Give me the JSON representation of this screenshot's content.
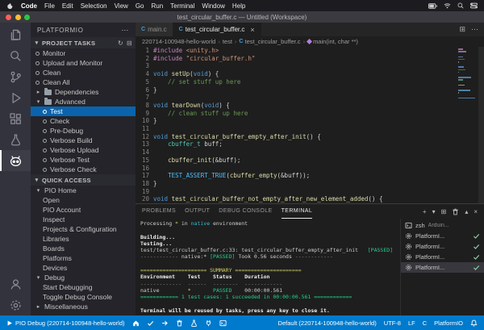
{
  "icons": {
    "more": "⋯",
    "refresh": "↻",
    "collapse": "⊟",
    "chevron_down": "▾",
    "chevron_right": "▸",
    "close": "×",
    "plus": "+",
    "split": "⊞",
    "chevron_up": "▴",
    "overflow": "⋯",
    "breadcrumb_sep": "›"
  },
  "menubar": {
    "app_name": "Code",
    "items": [
      "File",
      "Edit",
      "Selection",
      "View",
      "Go",
      "Run",
      "Terminal",
      "Window",
      "Help"
    ],
    "status_icons": [
      "battery",
      "wifi",
      "search",
      "control-center"
    ]
  },
  "titlebar": {
    "title": "test_circular_buffer.c — Untitled (Workspace)"
  },
  "activity_bar": {
    "items": [
      {
        "name": "explorer",
        "active": false
      },
      {
        "name": "search",
        "active": false
      },
      {
        "name": "source-control",
        "active": false
      },
      {
        "name": "run-and-debug",
        "active": false
      },
      {
        "name": "extensions",
        "active": false
      },
      {
        "name": "testing",
        "active": false
      },
      {
        "name": "platformio",
        "active": true
      },
      {
        "name": "accounts",
        "active": false,
        "bottom": true
      },
      {
        "name": "settings",
        "active": false,
        "bottom": true
      }
    ]
  },
  "sidebar": {
    "title": "PLATFORMIO",
    "sections": [
      {
        "label": "PROJECT TASKS",
        "items": [
          {
            "icon": "task",
            "label": "Monitor",
            "indent": 0
          },
          {
            "icon": "task",
            "label": "Upload and Monitor",
            "indent": 0
          },
          {
            "icon": "task",
            "label": "Clean",
            "indent": 0
          },
          {
            "icon": "task",
            "label": "Clean All",
            "indent": 0
          },
          {
            "icon": "folder-closed",
            "label": "Dependencies",
            "indent": 0
          },
          {
            "icon": "folder-open",
            "label": "Advanced",
            "indent": 0
          },
          {
            "icon": "task",
            "label": "Test",
            "indent": 1,
            "selected": true
          },
          {
            "icon": "task",
            "label": "Check",
            "indent": 1
          },
          {
            "icon": "task",
            "label": "Pre-Debug",
            "indent": 1
          },
          {
            "icon": "task",
            "label": "Verbose Build",
            "indent": 1
          },
          {
            "icon": "task",
            "label": "Verbose Upload",
            "indent": 1
          },
          {
            "icon": "task",
            "label": "Verbose Test",
            "indent": 1
          },
          {
            "icon": "task",
            "label": "Verbose Check",
            "indent": 1
          }
        ]
      },
      {
        "label": "QUICK ACCESS",
        "items": [
          {
            "icon": "chevron-down",
            "label": "PIO Home",
            "indent": 0
          },
          {
            "icon": "none",
            "label": "Open",
            "indent": 1
          },
          {
            "icon": "none",
            "label": "PIO Account",
            "indent": 1
          },
          {
            "icon": "none",
            "label": "Inspect",
            "indent": 1
          },
          {
            "icon": "none",
            "label": "Projects & Configuration",
            "indent": 1
          },
          {
            "icon": "none",
            "label": "Libraries",
            "indent": 1
          },
          {
            "icon": "none",
            "label": "Boards",
            "indent": 1
          },
          {
            "icon": "none",
            "label": "Platforms",
            "indent": 1
          },
          {
            "icon": "none",
            "label": "Devices",
            "indent": 1
          },
          {
            "icon": "chevron-down",
            "label": "Debug",
            "indent": 0
          },
          {
            "icon": "none",
            "label": "Start Debugging",
            "indent": 1
          },
          {
            "icon": "none",
            "label": "Toggle Debug Console",
            "indent": 1
          },
          {
            "icon": "chevron-right",
            "label": "Miscellaneous",
            "indent": 0
          }
        ]
      }
    ]
  },
  "editor": {
    "tabs": [
      {
        "label": "main.c",
        "active": false
      },
      {
        "label": "test_circular_buffer.c",
        "active": true
      }
    ],
    "breadcrumb": [
      {
        "label": "220714-100948-hello-world",
        "icon": "none"
      },
      {
        "label": "test",
        "icon": "none"
      },
      {
        "label": "test_circular_buffer.c",
        "icon": "c-file"
      },
      {
        "label": "main(int, char **)",
        "icon": "symbol-method"
      }
    ],
    "code_lines": [
      {
        "n": 1,
        "tokens": [
          [
            "pp",
            "#include"
          ],
          [
            "pl",
            " "
          ],
          [
            "str",
            "<unity.h>"
          ]
        ]
      },
      {
        "n": 2,
        "tokens": [
          [
            "pp",
            "#include"
          ],
          [
            "pl",
            " "
          ],
          [
            "str",
            "\"circular_buffer.h\""
          ]
        ]
      },
      {
        "n": 3,
        "tokens": []
      },
      {
        "n": 4,
        "tokens": [
          [
            "kw",
            "void"
          ],
          [
            "pl",
            " "
          ],
          [
            "fn",
            "setUp"
          ],
          [
            "pl",
            "("
          ],
          [
            "kw",
            "void"
          ],
          [
            "pl",
            ") {"
          ]
        ]
      },
      {
        "n": 5,
        "tokens": [
          [
            "cm",
            "    // set stuff up here"
          ]
        ]
      },
      {
        "n": 6,
        "tokens": [
          [
            "pl",
            "}"
          ]
        ]
      },
      {
        "n": 7,
        "tokens": []
      },
      {
        "n": 8,
        "tokens": [
          [
            "kw",
            "void"
          ],
          [
            "pl",
            " "
          ],
          [
            "fn",
            "tearDown"
          ],
          [
            "pl",
            "("
          ],
          [
            "kw",
            "void"
          ],
          [
            "pl",
            ") {"
          ]
        ]
      },
      {
        "n": 9,
        "tokens": [
          [
            "cm",
            "    // clean stuff up here"
          ]
        ]
      },
      {
        "n": 10,
        "tokens": [
          [
            "pl",
            "}"
          ]
        ]
      },
      {
        "n": 11,
        "tokens": []
      },
      {
        "n": 12,
        "tokens": [
          [
            "kw",
            "void"
          ],
          [
            "pl",
            " "
          ],
          [
            "fn",
            "test_circular_buffer_empty_after_init"
          ],
          [
            "pl",
            "() {"
          ]
        ]
      },
      {
        "n": 13,
        "tokens": [
          [
            "pl",
            "    "
          ],
          [
            "ty",
            "cbuffer_t"
          ],
          [
            "pl",
            " buff;"
          ]
        ]
      },
      {
        "n": 14,
        "tokens": []
      },
      {
        "n": 15,
        "tokens": [
          [
            "pl",
            "    "
          ],
          [
            "fn",
            "cbuffer_init"
          ],
          [
            "pl",
            "(&buff);"
          ]
        ]
      },
      {
        "n": 16,
        "tokens": []
      },
      {
        "n": 17,
        "tokens": [
          [
            "pl",
            "    "
          ],
          [
            "mac",
            "TEST_ASSERT_TRUE"
          ],
          [
            "pl",
            "("
          ],
          [
            "fn",
            "cbuffer_empty"
          ],
          [
            "pl",
            "(&buff));"
          ]
        ]
      },
      {
        "n": 18,
        "tokens": [
          [
            "pl",
            "}"
          ]
        ]
      },
      {
        "n": 19,
        "tokens": []
      },
      {
        "n": 20,
        "tokens": [
          [
            "kw",
            "void"
          ],
          [
            "pl",
            " "
          ],
          [
            "fn",
            "test_circular_buffer_not_empty_after_new_element_added"
          ],
          [
            "pl",
            "() {"
          ]
        ]
      }
    ]
  },
  "panel": {
    "tabs": [
      {
        "label": "PROBLEMS",
        "active": false
      },
      {
        "label": "OUTPUT",
        "active": false
      },
      {
        "label": "DEBUG CONSOLE",
        "active": false
      },
      {
        "label": "TERMINAL",
        "active": true
      }
    ],
    "actions": [
      "plus",
      "chevron-down",
      "split",
      "trash",
      "chevron-up",
      "close"
    ],
    "terminal_lines": [
      {
        "tokens": [
          [
            "d",
            "Processing "
          ],
          [
            "y",
            "*"
          ],
          [
            "d",
            " in "
          ],
          [
            "c",
            "native"
          ],
          [
            "d",
            " environment"
          ]
        ]
      },
      {
        "tokens": []
      },
      {
        "tokens": [
          [
            "b",
            "Building..."
          ]
        ]
      },
      {
        "tokens": [
          [
            "b",
            "Testing..."
          ]
        ]
      },
      {
        "tokens": [
          [
            "d",
            "test/test_circular_buffer.c:33: test_circular_buffer_empty_after_init   "
          ],
          [
            "g",
            "[PASSED]"
          ]
        ]
      },
      {
        "tokens": [
          [
            "dim",
            "------------ "
          ],
          [
            "d",
            "native:* "
          ],
          [
            "g",
            "[PASSED]"
          ],
          [
            "d",
            " Took 0.56 seconds "
          ],
          [
            "dim",
            "------------"
          ]
        ]
      },
      {
        "tokens": []
      },
      {
        "tokens": [
          [
            "y",
            "===================== SUMMARY ====================="
          ]
        ]
      },
      {
        "tokens": [
          [
            "b",
            "Environment    Test    Status    Duration"
          ]
        ]
      },
      {
        "tokens": [
          [
            "dim",
            "-------------  ------  --------  ------------"
          ]
        ]
      },
      {
        "tokens": [
          [
            "d",
            "native         "
          ],
          [
            "y",
            "*"
          ],
          [
            "d",
            "       "
          ],
          [
            "g",
            "PASSED"
          ],
          [
            "d",
            "    00:00:00.561"
          ]
        ]
      },
      {
        "tokens": [
          [
            "g",
            "============ 1 test cases: 1 succeeded in 00:00:00.561 ============"
          ]
        ]
      },
      {
        "tokens": []
      },
      {
        "tokens": [
          [
            "b",
            "Terminal will be reused by tasks, press any key to close it."
          ]
        ]
      }
    ],
    "terminal_list": [
      {
        "icon": "terminal",
        "label": "zsh",
        "desc": "Arduin...",
        "check": false,
        "selected": false
      },
      {
        "icon": "tools",
        "label": "PlatformI...",
        "desc": "",
        "check": true,
        "selected": false
      },
      {
        "icon": "tools",
        "label": "PlatformI...",
        "desc": "",
        "check": true,
        "selected": false
      },
      {
        "icon": "tools",
        "label": "PlatformI...",
        "desc": "",
        "check": true,
        "selected": false
      },
      {
        "icon": "tools",
        "label": "PlatformI...",
        "desc": "",
        "check": true,
        "selected": true
      }
    ]
  },
  "status_bar": {
    "left": [
      {
        "icon": "debug-play",
        "label": "PIO Debug (220714-100948-hello-world)",
        "name": "debug-configuration"
      },
      {
        "icon": "home",
        "label": "",
        "name": "pio-home"
      },
      {
        "icon": "check",
        "label": "",
        "name": "pio-build"
      },
      {
        "icon": "arrow-right",
        "label": "",
        "name": "pio-upload"
      },
      {
        "icon": "trash",
        "label": "",
        "name": "pio-clean"
      },
      {
        "icon": "beaker",
        "label": "",
        "name": "pio-test"
      },
      {
        "icon": "plug",
        "label": "",
        "name": "pio-serial-monitor"
      },
      {
        "icon": "terminal",
        "label": "",
        "name": "pio-new-terminal"
      }
    ],
    "right": [
      {
        "icon": "",
        "label": "Default (220714-100948-hello-world)",
        "name": "pio-env-switcher"
      },
      {
        "icon": "",
        "label": "UTF-8",
        "name": "encoding-indicator"
      },
      {
        "icon": "",
        "label": "LF",
        "name": "eol-indicator"
      },
      {
        "icon": "",
        "label": "C",
        "name": "language-mode"
      },
      {
        "icon": "",
        "label": "PlatformIO",
        "name": "platformio-indicator"
      },
      {
        "icon": "bell",
        "label": "",
        "name": "notifications-bell"
      }
    ]
  }
}
